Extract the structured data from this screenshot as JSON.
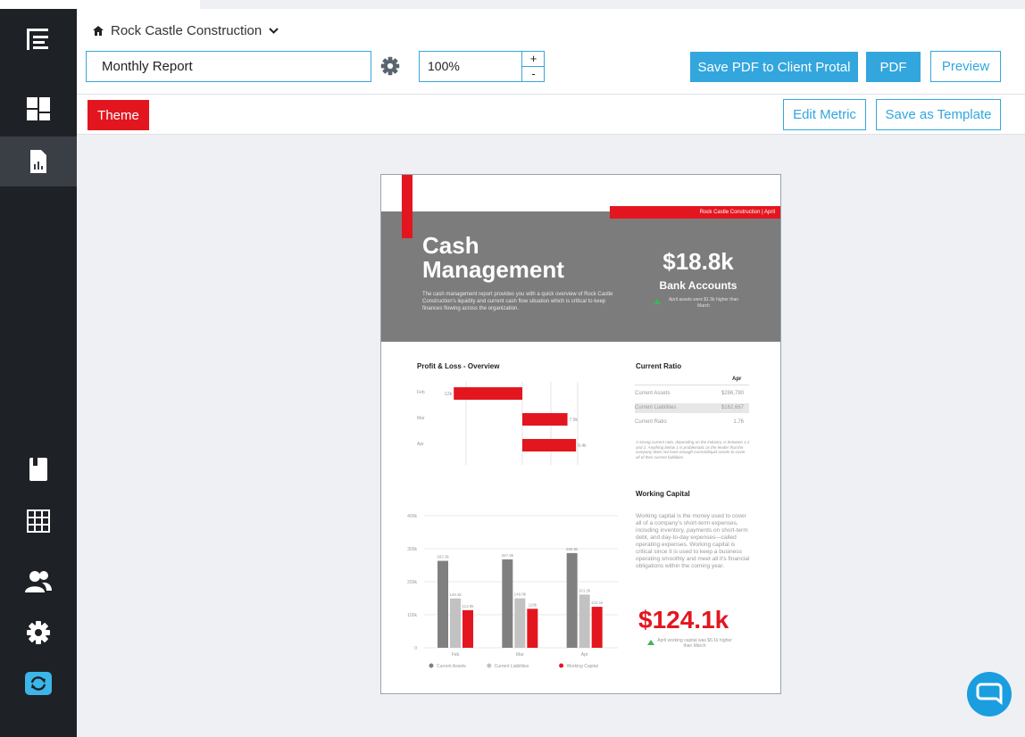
{
  "header": {
    "company": "Rock Castle Construction",
    "report_name": "Monthly Report",
    "zoom": "100%",
    "zoom_plus": "+",
    "zoom_minus": "-",
    "save_pdf_label": "Save PDF to Client Protal",
    "pdf_label": "PDF",
    "preview_label": "Preview"
  },
  "toolbar": {
    "theme_label": "Theme",
    "edit_metric_label": "Edit Metric",
    "save_template_label": "Save as Template"
  },
  "sidebar": {
    "items": [
      "menu-icon",
      "dashboard-icon",
      "report-icon",
      "bookmark-icon",
      "grid-icon",
      "users-icon",
      "gear-icon",
      "sync-icon"
    ]
  },
  "colors": {
    "accent": "#33a6de",
    "red": "#e3161f",
    "sidebar": "#1e2126",
    "gray": "#7c7c7c"
  },
  "report": {
    "tag": "Rock Castle Construction | April",
    "title_line1": "Cash",
    "title_line2": "Management",
    "description": "The cash management report provides you with a quick overview of Rock Castle Construction's liquidity and current cash flow situation which is critical to keep finances flowing across the organization.",
    "bank_value": "$18.8k",
    "bank_label": "Bank Accounts",
    "bank_note": "April assets were $1.5k higher than March",
    "pl_title": "Profit & Loss - Overview",
    "ratio_title": "Current Ratio",
    "ratio_col": "Apr",
    "ratio_rows": [
      {
        "label": "Current Assets",
        "value": "$286,790"
      },
      {
        "label": "Current Liabilities",
        "value": "$162,667"
      },
      {
        "label": "Current Ratio",
        "value": "1.76"
      }
    ],
    "ratio_note": "A strong current ratio, depending on the industry, is between 1.2 and 2. Anything below 1 is problematic as the lender that the company does not have enough current/liquid assets to cover all of their current liabilities.",
    "wc_title": "Working Capital",
    "wc_text": "Working capital is the money used to cover all of a company's short-term expenses, including inventory, payments on short-term debt, and day-to-day expenses—called operating expenses. Working capital is critical since it is used to keep a business operating smoothly and meet all it's financial obligations within the coming year.",
    "wc_value": "$124.1k",
    "wc_note": "April working capital was $6.1k higher than March"
  },
  "chart_data": [
    {
      "type": "bar",
      "title": "Profit & Loss - Overview",
      "categories": [
        "Feb",
        "Mar",
        "Apr"
      ],
      "values": [
        -12,
        7.9,
        9.4
      ],
      "value_labels": [
        "-12k",
        "7.9k",
        "9.4k"
      ],
      "orientation": "horizontal"
    },
    {
      "type": "bar",
      "categories": [
        "Feb",
        "Mar",
        "Apr"
      ],
      "ylim": [
        0,
        400
      ],
      "yticks": [
        "0",
        "100k",
        "200k",
        "300k",
        "400k"
      ],
      "series": [
        {
          "name": "Current Assets",
          "values": [
            263.3,
            267.8,
            286.8
          ],
          "labels": [
            "263.3k",
            "267.8k",
            "286.8k"
          ],
          "color": "#808080"
        },
        {
          "name": "Current Liabilities",
          "values": [
            149.3,
            149.8,
            161.2
          ],
          "labels": [
            "149.3k",
            "149.8k",
            "161.2k"
          ],
          "color": "#c2c2c2"
        },
        {
          "name": "Working Capital",
          "values": [
            113.9,
            118,
            124.1
          ],
          "labels": [
            "113.9k",
            "118k",
            "124.1k"
          ],
          "color": "#e3161f"
        }
      ],
      "legend": "bottom"
    }
  ]
}
